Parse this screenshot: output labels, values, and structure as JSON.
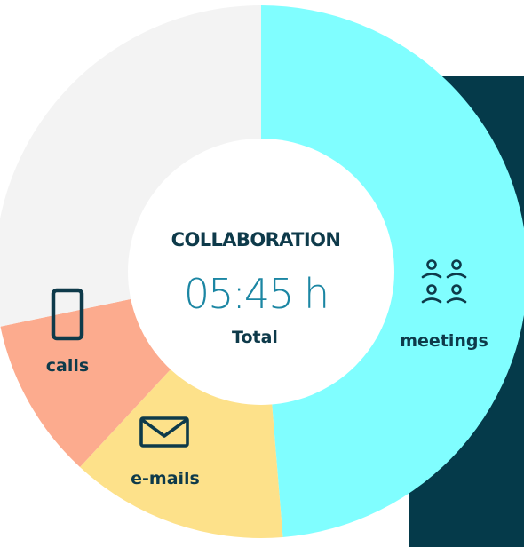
{
  "chart_data": {
    "type": "pie",
    "donut": true,
    "center": {
      "title": "COLLABORATION",
      "value": "05:45 h",
      "subtitle": "Total"
    },
    "slices": [
      {
        "label": "meetings",
        "share": 0.487,
        "color": "#80feff",
        "icon": "people-icon"
      },
      {
        "label": "e-mails",
        "share": 0.132,
        "color": "#fde18a",
        "icon": "envelope-icon"
      },
      {
        "label": "calls",
        "share": 0.098,
        "color": "#fcab8e",
        "icon": "phone-icon"
      },
      {
        "label": "",
        "share": 0.283,
        "color": "#f3f3f3",
        "icon": ""
      }
    ]
  },
  "colors": {
    "backdrop": "#053a4a",
    "text_dark": "#0e3a4a",
    "value_blue": "#1b86a3",
    "hole": "#ffffff"
  }
}
